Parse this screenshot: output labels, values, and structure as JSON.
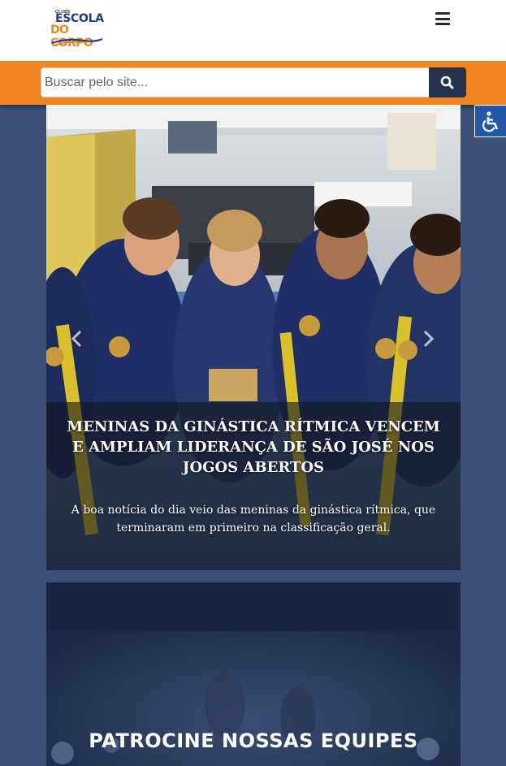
{
  "header": {
    "logo_small": "CLUBE",
    "logo_line1": "ESCOLA",
    "logo_line2": "DO CORPO",
    "menu_icon": "hamburger-menu-icon"
  },
  "search": {
    "placeholder": "Buscar pelo site...",
    "value": "",
    "button_icon": "search-icon"
  },
  "accessibility": {
    "icon": "wheelchair-accessibility-icon"
  },
  "carousel": {
    "prev_icon": "chevron-left-icon",
    "next_icon": "chevron-right-icon",
    "slide": {
      "title": "MENINAS DA GINÁSTICA RÍTMICA VENCEM E AMPLIAM LIDERANÇA DE SÃO JOSÉ NOS JOGOS ABERTOS",
      "text": "A boa notícia do dia veio das meninas da ginástica rítmica, que terminaram em primeiro na classificação geral."
    }
  },
  "sponsor": {
    "title": "PATROCINE NOSSAS EQUIPES"
  },
  "colors": {
    "page_bg": "#3d5078",
    "search_bar": "#ef8620",
    "search_button": "#24344f",
    "accessibility_button": "#2457a7",
    "logo_blue": "#1f3c88",
    "logo_orange": "#ef8620"
  }
}
